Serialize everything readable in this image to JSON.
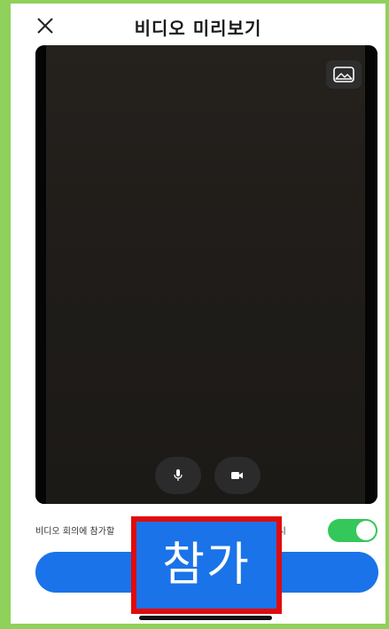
{
  "header": {
    "title": "비디오 미리보기",
    "close_icon": "close-icon"
  },
  "preview": {
    "background_icon": "virtual-background-icon",
    "mic_icon": "microphone-icon",
    "camera_icon": "video-camera-icon"
  },
  "settings": {
    "preview_toggle_label_left": "비디오 회의에 참가할",
    "preview_toggle_label_right": "자 표시",
    "preview_toggle_on": true
  },
  "join": {
    "label": "참가"
  },
  "colors": {
    "accent": "#1a73e8",
    "toggle_on": "#34c759",
    "highlight": "#e10b0b",
    "frame": "#8fd15a"
  }
}
